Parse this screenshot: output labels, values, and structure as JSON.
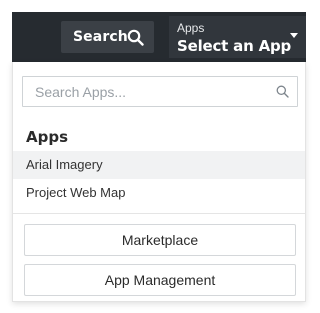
{
  "header": {
    "search_label": "Search",
    "search_icon": "search-icon",
    "app_select": {
      "caption": "Apps",
      "value": "Select an App",
      "icon": "caret-down-icon"
    },
    "colors": {
      "bar_background": "#262b30",
      "button_background": "#3b4046"
    }
  },
  "dropdown": {
    "search": {
      "placeholder": "Search Apps...",
      "value": "",
      "icon": "search-icon"
    },
    "section_title": "Apps",
    "apps": [
      {
        "label": "Arial Imagery",
        "highlighted": true
      },
      {
        "label": "Project Web Map",
        "highlighted": false
      }
    ],
    "buttons": {
      "marketplace": "Marketplace",
      "app_management": "App Management"
    }
  }
}
